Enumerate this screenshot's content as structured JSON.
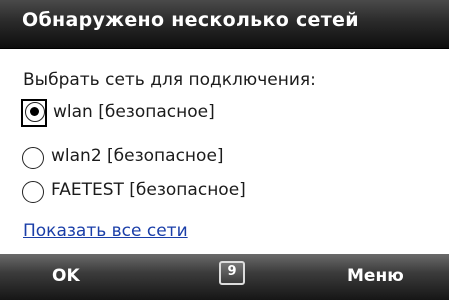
{
  "title": "Обнаружено несколько сетей",
  "prompt": "Выбрать сеть для подключения:",
  "networks": [
    {
      "label": "wlan [безопасное]",
      "selected": true
    },
    {
      "label": "wlan2 [безопасное]",
      "selected": false
    },
    {
      "label": "FAETEST [безопасное]",
      "selected": false
    }
  ],
  "link": "Показать все сети",
  "softkeys": {
    "left": "OK",
    "right": "Меню"
  },
  "keyboard_icon": "keyboard-icon",
  "keyboard_glyph": "9"
}
